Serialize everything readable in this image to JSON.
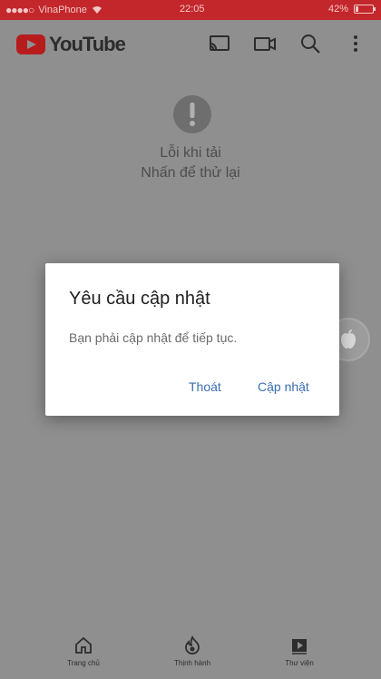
{
  "status_bar": {
    "carrier": "VinaPhone",
    "time": "22:05",
    "battery": "42%"
  },
  "app_bar": {
    "logo_text": "YouTube",
    "icons": [
      "cast-icon",
      "camera-icon",
      "search-icon",
      "more-vert-icon"
    ]
  },
  "error": {
    "line1": "Lỗi khi tải",
    "line2": "Nhấn để thử lại"
  },
  "dialog": {
    "title": "Yêu cầu cập nhật",
    "message": "Bạn phải cập nhật để tiếp tục.",
    "exit_label": "Thoát",
    "update_label": "Cập nhật"
  },
  "bottom_nav": {
    "items": [
      {
        "label": "Trang chủ",
        "icon": "home-icon"
      },
      {
        "label": "Thịnh hành",
        "icon": "trending-icon"
      },
      {
        "label": "Thư viện",
        "icon": "library-icon"
      }
    ]
  },
  "colors": {
    "status_bar": "#c3272b",
    "overlay_background": "#8f8f8f",
    "dialog_button": "#3a6fb3"
  }
}
